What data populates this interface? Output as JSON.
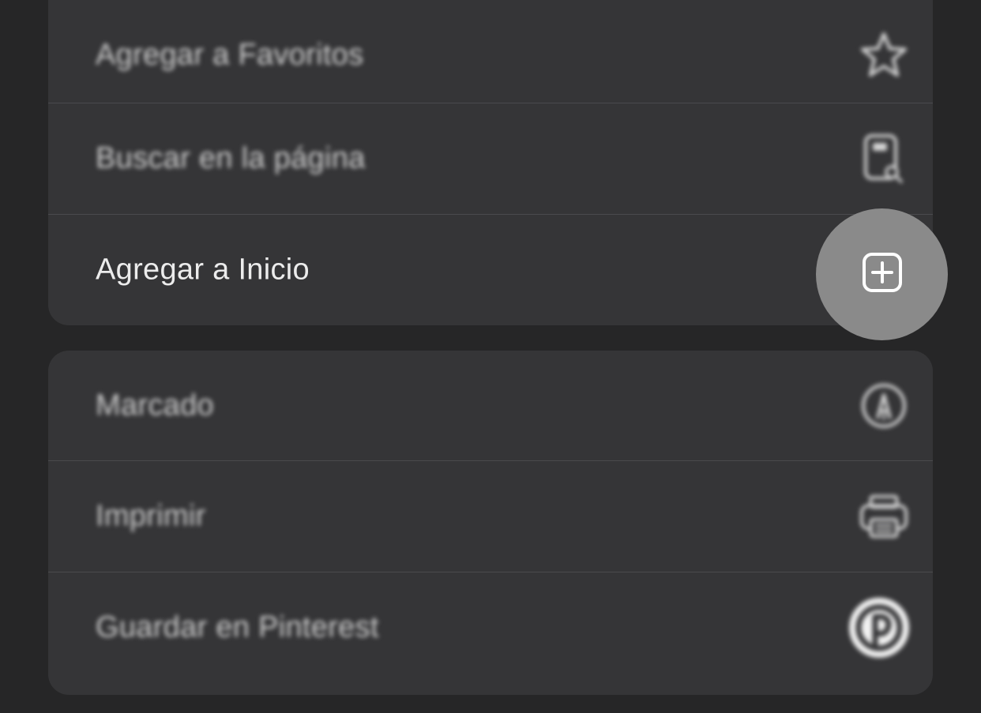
{
  "menu": {
    "group1": {
      "items": [
        {
          "label": "Agregar a Favoritos",
          "icon": "star-icon"
        },
        {
          "label": "Buscar en la página",
          "icon": "find-on-page-icon"
        },
        {
          "label": "Agregar a Inicio",
          "icon": "add-square-icon"
        }
      ]
    },
    "group2": {
      "items": [
        {
          "label": "Marcado",
          "icon": "markup-icon"
        },
        {
          "label": "Imprimir",
          "icon": "printer-icon"
        },
        {
          "label": "Guardar en Pinterest",
          "icon": "pinterest-icon"
        }
      ]
    }
  },
  "colors": {
    "background": "#262627",
    "menu_group": "#353537",
    "highlight": "#8a8a8a",
    "text": "#ececec"
  }
}
